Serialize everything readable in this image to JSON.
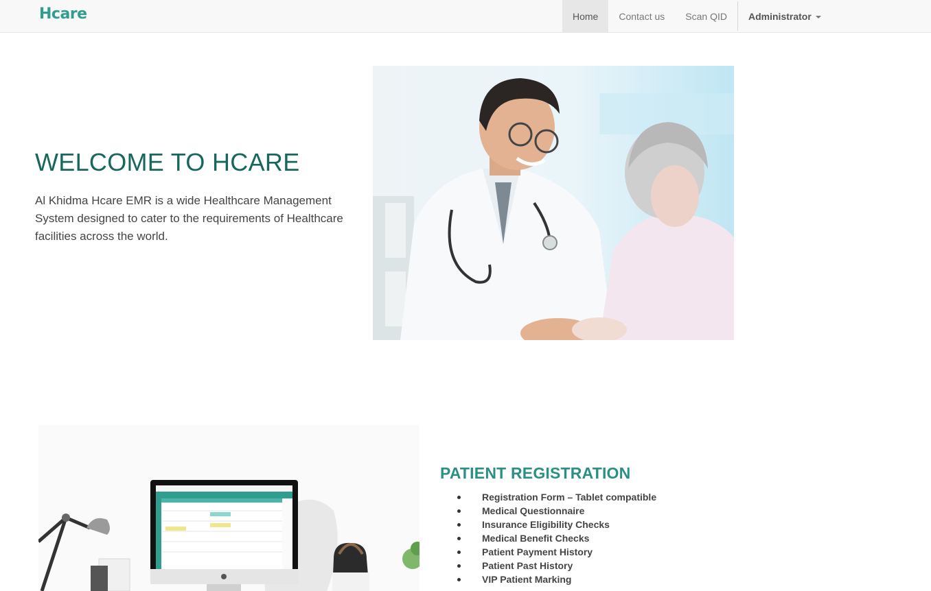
{
  "navbar": {
    "logo": "Hcare",
    "items": [
      {
        "label": "Home",
        "active": true
      },
      {
        "label": "Contact us",
        "active": false
      },
      {
        "label": "Scan QID",
        "active": false
      }
    ],
    "user_menu": "Administrator"
  },
  "hero": {
    "title": "WELCOME TO HCARE",
    "description": "Al Khidma Hcare EMR is a wide Healthcare Management System designed to cater to the requirements of Healthcare facilities across the world."
  },
  "registration": {
    "title": "PATIENT REGISTRATION",
    "features": [
      "Registration Form – Tablet compatible",
      "Medical Questionnaire",
      "Insurance Eligibility Checks",
      "Medical Benefit Checks",
      "Patient Payment History",
      "Patient Past History",
      "VIP Patient Marking"
    ]
  },
  "colors": {
    "brand": "#2f9e8f",
    "title": "#16675c",
    "navbar_bg": "#f8f8f8"
  }
}
